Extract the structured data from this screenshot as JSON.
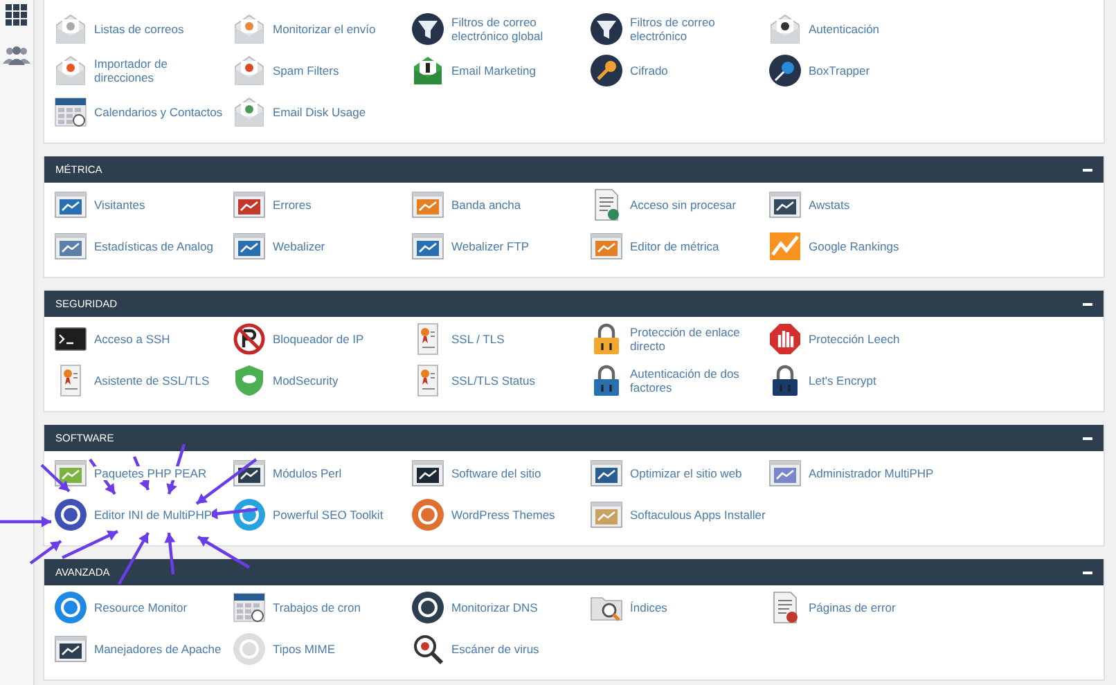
{
  "sections": [
    {
      "items": [
        "Listas de correos",
        "Monitorizar el envío",
        "Filtros de correo electrónico global",
        "Filtros de correo electrónico",
        "Autenticación",
        "Importador de direcciones",
        "Spam Filters",
        "Email Marketing",
        "Cifrado",
        "BoxTrapper",
        "Calendarios y Contactos",
        "Email Disk Usage"
      ]
    },
    {
      "title": "MÉTRICA",
      "items": [
        "Visitantes",
        "Errores",
        "Banda ancha",
        "Acceso sin procesar",
        "Awstats",
        "Estadísticas de Analog",
        "Webalizer",
        "Webalizer FTP",
        "Editor de métrica",
        "Google Rankings"
      ]
    },
    {
      "title": "SEGURIDAD",
      "items": [
        "Acceso a SSH",
        "Bloqueador de IP",
        "SSL / TLS",
        "Protección de enlace directo",
        "Protección Leech",
        "Asistente de SSL/TLS",
        "ModSecurity",
        "SSL/TLS Status",
        "Autenticación de dos factores",
        "Let's Encrypt"
      ]
    },
    {
      "title": "SOFTWARE",
      "items": [
        "Paquetes PHP PEAR",
        "Módulos Perl",
        "Software del sitio",
        "Optimizar el sitio web",
        "Administrador MultiPHP",
        "Editor INI de MultiPHP",
        "Powerful SEO Toolkit",
        "WordPress Themes",
        "Softaculous Apps Installer"
      ]
    },
    {
      "title": "AVANZADA",
      "items": [
        "Resource Monitor",
        "Trabajos de cron",
        "Monitorizar DNS",
        "Índices",
        "Páginas de error",
        "Manejadores de Apache",
        "Tipos MIME",
        "Escáner de virus"
      ]
    }
  ]
}
